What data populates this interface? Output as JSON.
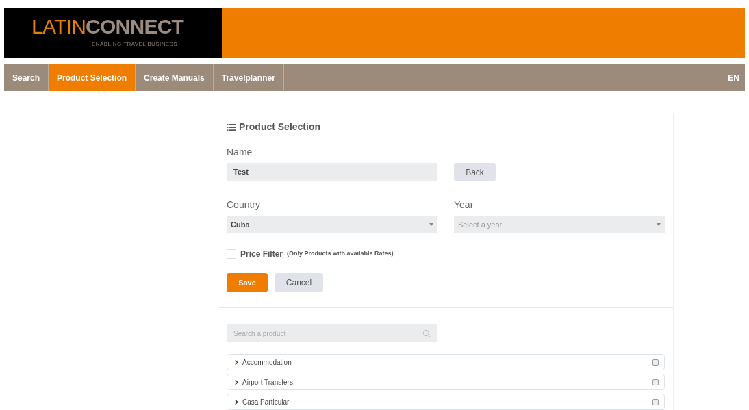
{
  "logo": {
    "part_1": "LATIN",
    "part_2": "CONNECT",
    "tagline": "ENABLING TRAVEL BUSINESS"
  },
  "nav": {
    "items": [
      {
        "label": "Search",
        "selected": false
      },
      {
        "label": "Product Selection",
        "selected": true
      },
      {
        "label": "Create Manuals",
        "selected": false
      },
      {
        "label": "Travelplanner",
        "selected": false
      }
    ],
    "language": "EN"
  },
  "form": {
    "title": "Product Selection",
    "name_label": "Name",
    "name_value": "Test",
    "back_button": "Back",
    "country_label": "Country",
    "country_value": "Cuba",
    "year_label": "Year",
    "year_placeholder": "Select a year",
    "price_filter": {
      "label": "Price Filter",
      "note": "(Only Products with available Rates)",
      "checked": false
    },
    "save_button": "Save",
    "cancel_button": "Cancel"
  },
  "products": {
    "search_placeholder": "Search a product",
    "categories": [
      {
        "label": "Accommodation",
        "expanded": false,
        "checked": false
      },
      {
        "label": "Airport Transfers",
        "expanded": false,
        "checked": false
      },
      {
        "label": "Casa Particular",
        "expanded": false,
        "checked": false
      }
    ]
  }
}
